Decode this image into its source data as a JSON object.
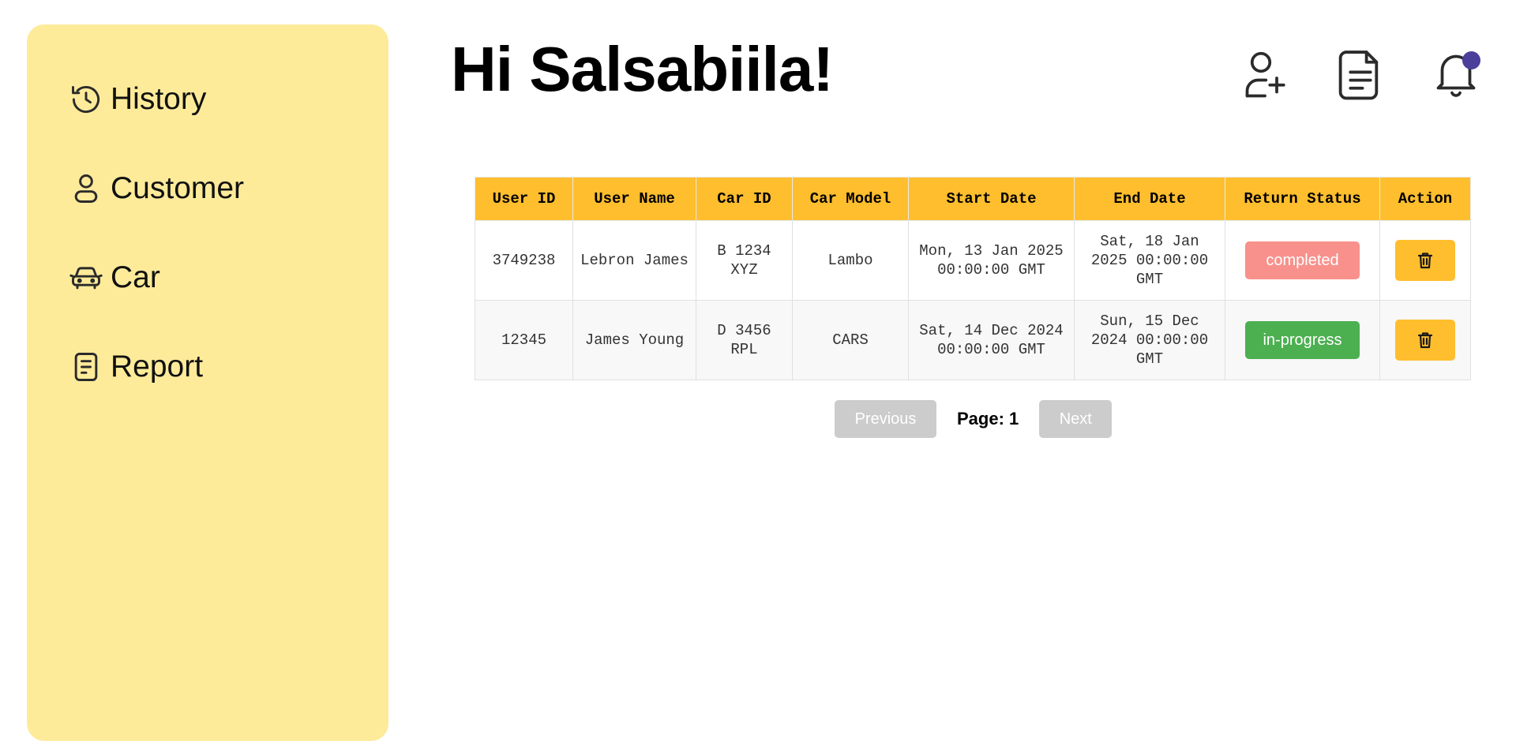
{
  "greeting": "Hi Salsabiila!",
  "sidebar": {
    "items": [
      {
        "label": "History",
        "icon": "history-icon"
      },
      {
        "label": "Customer",
        "icon": "user-icon"
      },
      {
        "label": "Car",
        "icon": "car-icon"
      },
      {
        "label": "Report",
        "icon": "report-icon"
      }
    ]
  },
  "header_icons": [
    "add-user-icon",
    "document-icon",
    "bell-icon"
  ],
  "table": {
    "headers": [
      "User ID",
      "User Name",
      "Car ID",
      "Car Model",
      "Start Date",
      "End Date",
      "Return Status",
      "Action"
    ],
    "rows": [
      {
        "user_id": "3749238",
        "user_name": "Lebron James",
        "car_id": "B 1234 XYZ",
        "car_model": "Lambo",
        "start_date": "Mon, 13 Jan 2025 00:00:00 GMT",
        "end_date": "Sat, 18 Jan 2025 00:00:00 GMT",
        "status": "completed",
        "status_color": "#f8918c"
      },
      {
        "user_id": "12345",
        "user_name": "James Young",
        "car_id": "D 3456 RPL",
        "car_model": "CARS",
        "start_date": "Sat, 14 Dec 2024 00:00:00 GMT",
        "end_date": "Sun, 15 Dec 2024 00:00:00 GMT",
        "status": "in-progress",
        "status_color": "#4caf50"
      }
    ]
  },
  "pagination": {
    "previous_label": "Previous",
    "page_label": "Page: 1",
    "next_label": "Next"
  },
  "colors": {
    "sidebar_bg": "#feeb9a",
    "accent": "#ffbe2e",
    "notification_dot": "#4a3f9a"
  }
}
